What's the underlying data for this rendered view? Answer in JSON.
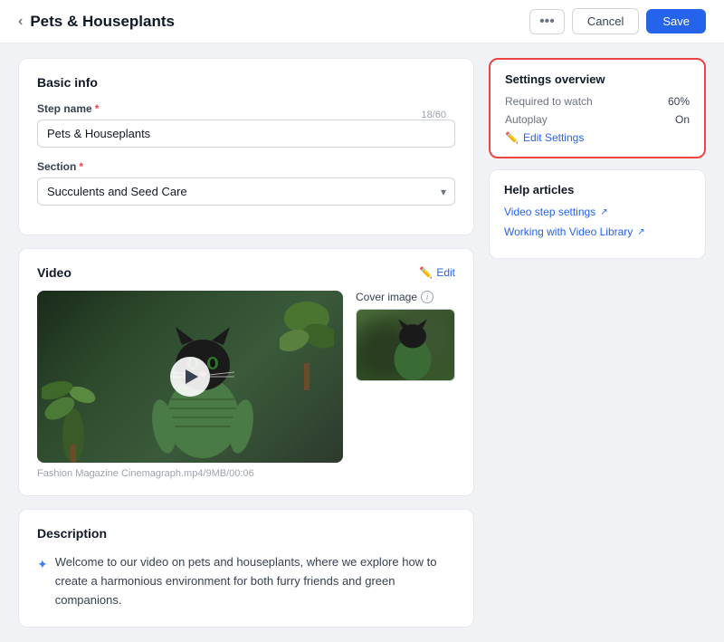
{
  "header": {
    "title": "Pets & Houseplants",
    "back_icon": "‹",
    "dots_label": "•••",
    "cancel_label": "Cancel",
    "save_label": "Save"
  },
  "basic_info": {
    "section_title": "Basic info",
    "step_name_label": "Step name",
    "step_name_value": "Pets & Houseplants",
    "step_name_char_count": "18/60",
    "section_label": "Section",
    "section_value": "Succulents and Seed Care"
  },
  "video": {
    "section_title": "Video",
    "edit_label": "Edit",
    "caption": "Fashion Magazine Cinemagraph.mp4/9MB/00:06",
    "cover_image_label": "Cover image"
  },
  "description": {
    "section_title": "Description",
    "text": "Welcome to our video on pets and houseplants, where we explore how to create a harmonious environment for both furry friends and green companions."
  },
  "settings_overview": {
    "title": "Settings overview",
    "required_label": "Required to watch",
    "required_value": "60%",
    "autoplay_label": "Autoplay",
    "autoplay_value": "On",
    "edit_label": "Edit Settings"
  },
  "help_articles": {
    "title": "Help articles",
    "link1": "Video step settings",
    "link2": "Working with Video Library"
  }
}
